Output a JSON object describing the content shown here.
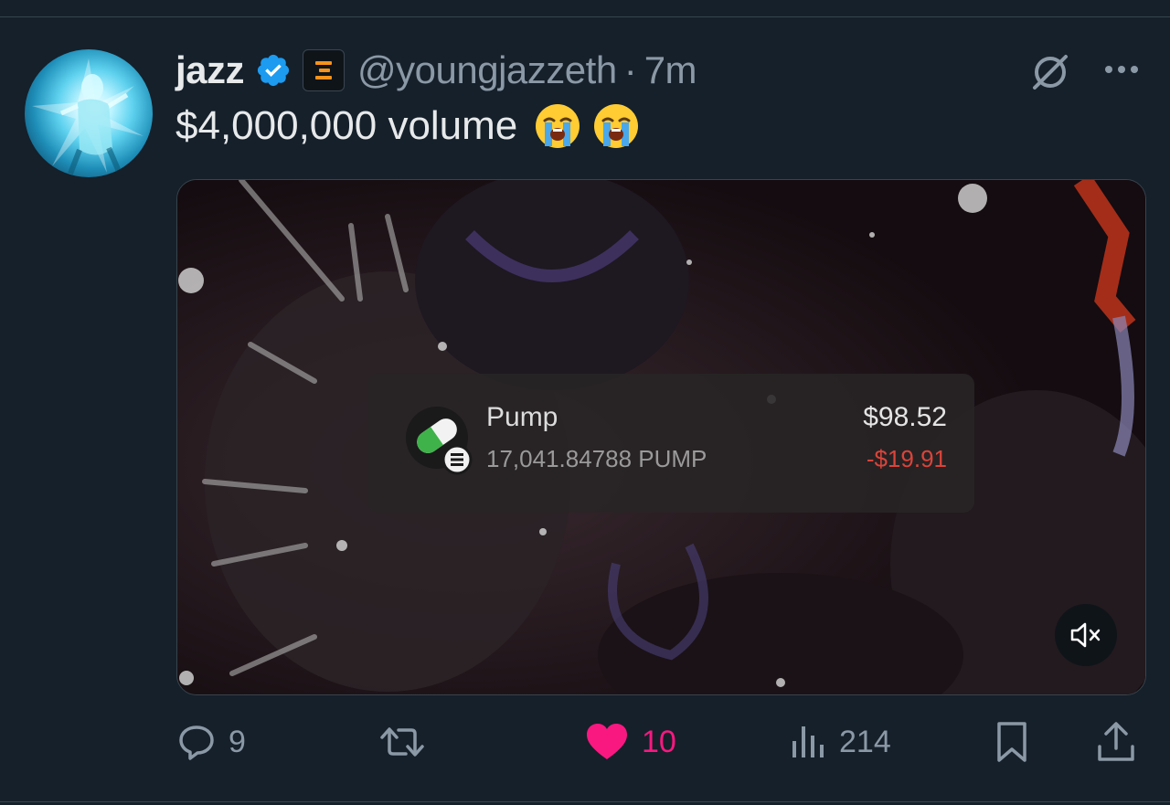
{
  "tweet": {
    "display_name": "jazz",
    "handle": "@youngjazzeth",
    "separator": "·",
    "time": "7m",
    "text": "$4,000,000 volume",
    "emojis": [
      "loudly-crying-face-emoji",
      "loudly-crying-face-emoji"
    ],
    "verified_color": "#1d9bf0"
  },
  "media": {
    "token_name": "Pump",
    "token_amount": "17,041.84788 PUMP",
    "value": "$98.52",
    "change": "-$19.91",
    "change_color": "#d9443a",
    "muted": true
  },
  "actions": {
    "replies": "9",
    "retweets": "",
    "likes": "10",
    "liked": true,
    "like_color": "#f91880",
    "views": "214"
  },
  "icons": [
    "verified-badge-icon",
    "affiliate-badge-icon",
    "grok-icon",
    "more-icon",
    "mute-icon",
    "reply-icon",
    "retweet-icon",
    "heart-icon",
    "views-icon",
    "bookmark-icon",
    "share-icon"
  ]
}
